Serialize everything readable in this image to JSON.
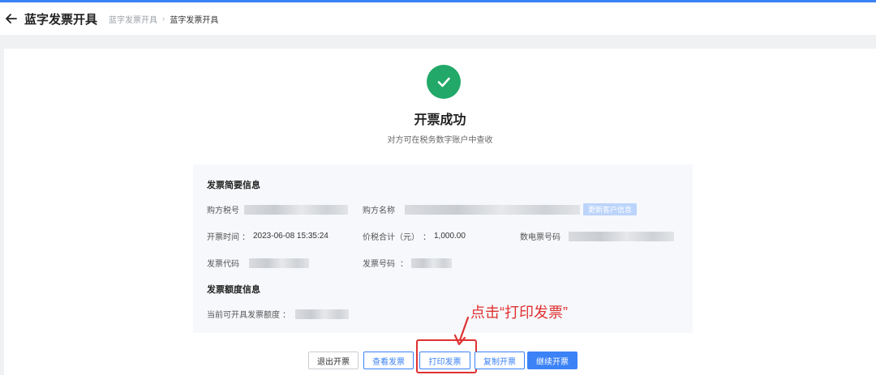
{
  "header": {
    "title": "蓝字发票开具",
    "breadcrumb": [
      "蓝字发票开具",
      "蓝字发票开具"
    ]
  },
  "result": {
    "title": "开票成功",
    "subtitle": "对方可在税务数字账户中查收"
  },
  "summary": {
    "title": "发票简要信息",
    "buyer_tax_label": "购方税号",
    "buyer_name_label": "购方名称",
    "update_customer_label": "更新客户信息",
    "issue_time_label": "开票时间",
    "issue_time_value": "2023-06-08 15:35:24",
    "total_label": "价税合计（元）",
    "total_value": "1,000.00",
    "e_invoice_no_label": "数电票号码",
    "invoice_code_label": "发票代码",
    "invoice_no_label": "发票号码"
  },
  "quota": {
    "title": "发票额度信息",
    "current_label": "当前可开具发票额度"
  },
  "annotation": "点击“打印发票”",
  "actions": {
    "exit": "退出开票",
    "view": "查看发票",
    "print": "打印发票",
    "copy": "复制开票",
    "continue": "继续开票"
  },
  "colors": {
    "accent": "#3b82f6",
    "success": "#22a868",
    "annotation": "#e03131"
  }
}
